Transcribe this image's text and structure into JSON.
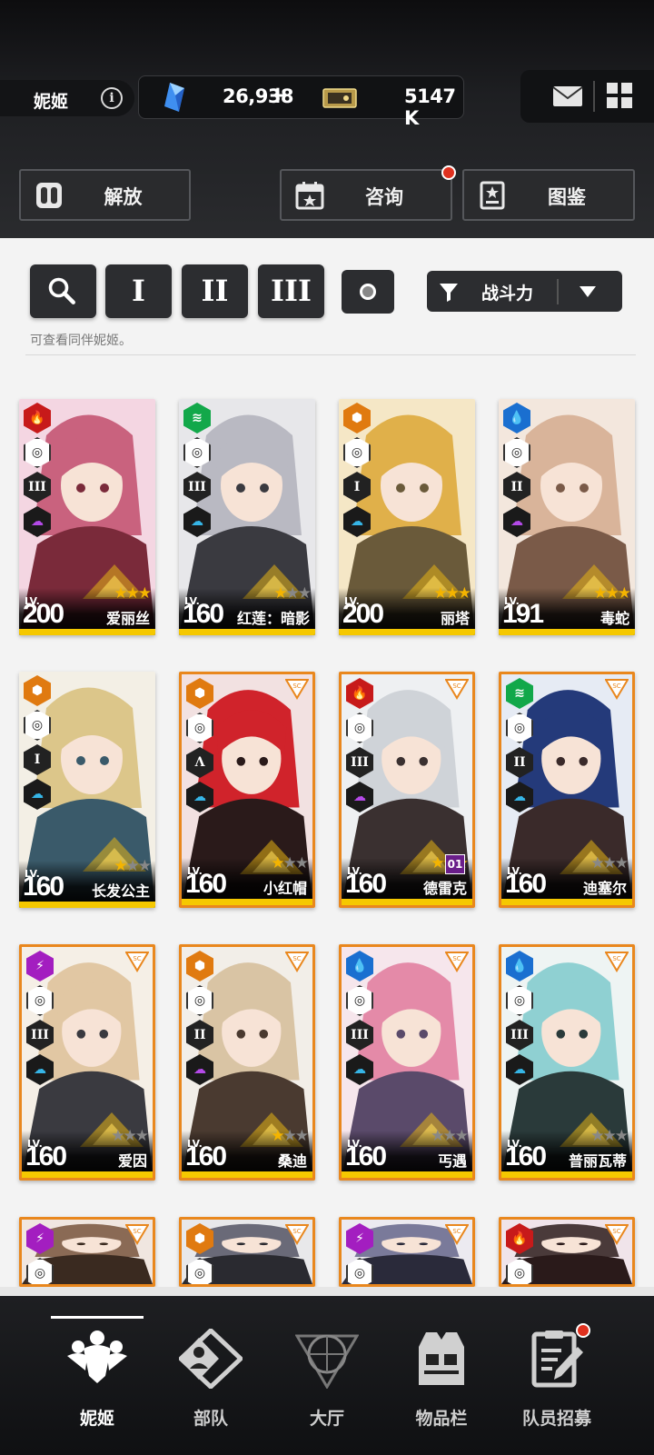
{
  "header": {
    "user_name": "妮姬",
    "gems": "26,938",
    "gems_plus": "+",
    "credits": "5147 K"
  },
  "top_buttons": {
    "release": "解放",
    "consult": "咨询",
    "codex": "图鉴"
  },
  "filters": {
    "burst_1": "I",
    "burst_2": "II",
    "burst_3": "III",
    "sort_label": "战斗力",
    "hint": "可查看同伴妮姬。"
  },
  "cards": [
    {
      "name": "爱丽丝",
      "lv_label": "LV.",
      "level": "200",
      "stars": 3,
      "element": "fire",
      "burst": "III",
      "frame": "gold"
    },
    {
      "name": "红莲：暗影",
      "lv_label": "LV.",
      "level": "160",
      "stars": 1,
      "element": "wind",
      "burst": "III",
      "frame": "gold"
    },
    {
      "name": "丽塔",
      "lv_label": "LV.",
      "level": "200",
      "stars": 3,
      "element": "iron",
      "burst": "I",
      "frame": "gold"
    },
    {
      "name": "毒蛇",
      "lv_label": "LV.",
      "level": "191",
      "stars": 3,
      "element": "water",
      "burst": "II",
      "frame": "gold"
    },
    {
      "name": "长发公主",
      "lv_label": "LV.",
      "level": "160",
      "stars": 1,
      "element": "iron",
      "burst": "I",
      "frame": "gold"
    },
    {
      "name": "小红帽",
      "lv_label": "LV.",
      "level": "160",
      "stars": 1,
      "element": "iron",
      "burst": "Λ",
      "frame": "orange"
    },
    {
      "name": "德雷克",
      "lv_label": "LV.",
      "level": "160",
      "stars": 3,
      "element": "fire",
      "burst": "III",
      "frame": "orange",
      "badge": "01"
    },
    {
      "name": "迪塞尔",
      "lv_label": "LV.",
      "level": "160",
      "stars": 0,
      "element": "wind",
      "burst": "II",
      "frame": "orange"
    },
    {
      "name": "爱因",
      "lv_label": "LV.",
      "level": "160",
      "stars": 0,
      "element": "elec",
      "burst": "III",
      "frame": "orange"
    },
    {
      "name": "桑迪",
      "lv_label": "LV.",
      "level": "160",
      "stars": 1,
      "element": "iron",
      "burst": "II",
      "frame": "orange"
    },
    {
      "name": "丐遇",
      "lv_label": "LV.",
      "level": "160",
      "stars": 0,
      "element": "water",
      "burst": "III",
      "frame": "orange"
    },
    {
      "name": "普丽瓦蒂",
      "lv_label": "LV.",
      "level": "160",
      "stars": 0,
      "element": "water",
      "burst": "III",
      "frame": "orange"
    },
    {
      "name": "",
      "lv_label": "",
      "level": "",
      "stars": 0,
      "element": "elec",
      "burst": "",
      "frame": "orange"
    },
    {
      "name": "",
      "lv_label": "",
      "level": "",
      "stars": 0,
      "element": "iron",
      "burst": "",
      "frame": "orange"
    },
    {
      "name": "",
      "lv_label": "",
      "level": "",
      "stars": 0,
      "element": "elec",
      "burst": "",
      "frame": "orange"
    },
    {
      "name": "",
      "lv_label": "",
      "level": "",
      "stars": 0,
      "element": "fire",
      "burst": "",
      "frame": "orange"
    }
  ],
  "nav": {
    "nikke": "妮姬",
    "squad": "部队",
    "lobby": "大厅",
    "inventory": "物品栏",
    "recruit": "队员招募"
  },
  "colors": {
    "accent_yellow": "#f5c800",
    "orange_frame": "#e9871d",
    "notification_red": "#e0311f"
  }
}
